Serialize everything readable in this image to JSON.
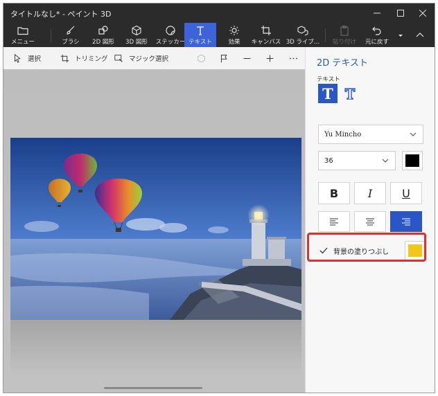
{
  "window": {
    "title": "タイトルなし* - ペイント 3D"
  },
  "ribbon": {
    "menu": "メニュー",
    "brush": "ブラシ",
    "shapes_2d": "2D 図形",
    "shapes_3d": "3D 図形",
    "stickers": "ステッカー",
    "text": "テキスト",
    "effects": "効果",
    "canvas": "キャンバス",
    "library_3d": "3D ライブ...",
    "paste": "貼り付け",
    "undo": "元に戻す"
  },
  "toolbar": {
    "select": "選択",
    "crop": "トリミング",
    "magic_select": "マジック選択"
  },
  "panel": {
    "title": "2D テキスト",
    "text_section": "テキスト",
    "font": "Yu Mincho",
    "size": "36",
    "text_color": "#000000",
    "bold": "B",
    "italic": "I",
    "underline": "U",
    "fill_label": "背景の塗りつぶし",
    "fill_checked": true,
    "fill_color": "#f5c518"
  },
  "colors": {
    "accent": "#3c63d8",
    "highlight": "#e12f2f"
  }
}
